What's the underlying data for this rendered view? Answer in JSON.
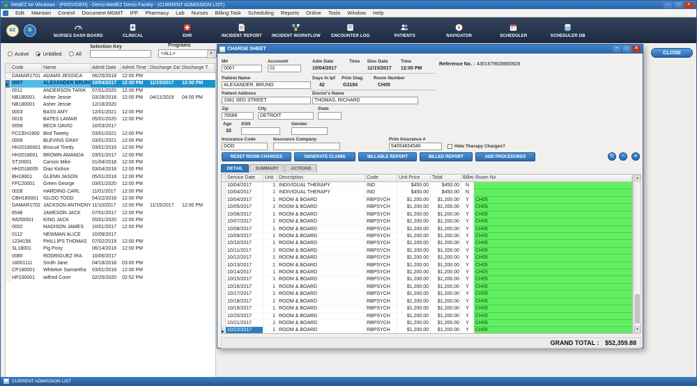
{
  "window": {
    "title": "MedEZ for Windows - [PROVIDER] - Demo-MedEZ Demo Facility - (CURRENT ADMISSION LIST)",
    "controls": {
      "minimize": "–",
      "maximize": "□",
      "close": "×"
    }
  },
  "menu": {
    "items": [
      "Edit",
      "Maintain",
      "Control",
      "Document MGMT",
      "IPF",
      "Pharmacy",
      "Lab",
      "Nurses",
      "Billing Task",
      "Scheduling",
      "Reports",
      "Online",
      "Tools",
      "Window",
      "Help"
    ]
  },
  "toolbar": {
    "badges": [
      {
        "label": "EZ"
      },
      {
        "label": "D"
      }
    ],
    "items": [
      {
        "label": "NURSES DASH BOARD",
        "icon": "dashboard-icon"
      },
      {
        "label": "CLINICAL",
        "icon": "clinical-icon"
      },
      {
        "label": "EHR",
        "icon": "ehr-icon"
      },
      {
        "label": "INCIDENT REPORT",
        "icon": "incident-report-icon"
      },
      {
        "label": "INCIDENT WORKFLOW",
        "icon": "incident-workflow-icon"
      },
      {
        "label": "ENCOUNTER LOG",
        "icon": "encounter-log-icon"
      },
      {
        "label": "PATIENTS",
        "icon": "patients-icon"
      },
      {
        "label": "NAVIGATOR",
        "icon": "navigator-icon"
      },
      {
        "label": "SCHEDULER",
        "icon": "scheduler-icon"
      },
      {
        "label": "SCHEDULER DB",
        "icon": "scheduler-db-icon"
      }
    ]
  },
  "filters": {
    "radios": [
      {
        "label": "Active",
        "checked": false
      },
      {
        "label": "Unbilled",
        "checked": true
      },
      {
        "label": "All",
        "checked": false
      }
    ],
    "selection_key_label": "Selection Key",
    "selection_key_value": "",
    "programs_label": "Programs",
    "programs_value": "<ALL>"
  },
  "close_button_label": "CLOSE",
  "admission_grid": {
    "columns": [
      "Code",
      "Name",
      "Admit Date",
      "Admit Time",
      "Discharge Date",
      "Discharge T"
    ],
    "selected_index": 1,
    "rows": [
      [
        "DAMAR1701",
        "ADAMS JESSICA",
        "06/25/2018",
        "12:00 PM",
        "",
        ""
      ],
      [
        "0067",
        "ALEXANDER BRUNO",
        "10/04/2017",
        "12:00 PM",
        "11/15/2017",
        "12:00 PM"
      ],
      [
        "0011",
        "ANDERSON TARIK",
        "07/01/2020",
        "12:00 PM",
        "",
        ""
      ],
      [
        "NB180001",
        "Asher Jessie",
        "03/28/2018",
        "12:00 PM",
        "04/11/2019",
        "04:00 PM"
      ],
      [
        "NB180001",
        "Asher Jessie",
        "12/18/2020",
        "",
        "",
        ""
      ],
      [
        "0003",
        "BASS AMY",
        "12/01/2021",
        "12:00 PM",
        "",
        ""
      ],
      [
        "0016",
        "BATES LAMAR",
        "05/01/2020",
        "12:00 PM",
        "",
        ""
      ],
      [
        "0058",
        "BECK DAVID",
        "10/03/2017",
        "",
        "",
        ""
      ],
      [
        "FCCEH1900",
        "Bird Tweety",
        "03/01/2021",
        "12:00 PM",
        "",
        ""
      ],
      [
        "0009",
        "BLEVINS GRAY",
        "03/01/2021",
        "12:00 PM",
        "",
        ""
      ],
      [
        "HH20180001",
        "Briscuit Tiredy",
        "03/01/2016",
        "12:00 PM",
        "",
        ""
      ],
      [
        "HH2018001",
        "BROWN AMANDA",
        "03/01/2017",
        "12:00 PM",
        "",
        ""
      ],
      [
        "ST20001",
        "Carson Mike",
        "01/04/2018",
        "12:00 PM",
        "",
        ""
      ],
      [
        "HH2018005",
        "Diaz Kishon",
        "03/04/2018",
        "12:00 PM",
        "",
        ""
      ],
      [
        "BH18001",
        "GLENN JASON",
        "05/01/2018",
        "12:00 PM",
        "",
        ""
      ],
      [
        "FFC20001",
        "Green George",
        "03/01/2020",
        "12:00 PM",
        "",
        ""
      ],
      [
        "0028",
        "HARDING CARL",
        "11/01/2017",
        "12:00 PM",
        "",
        ""
      ],
      [
        "CBH180001",
        "IGLOO TODD",
        "04/22/2018",
        "12:00 PM",
        "",
        ""
      ],
      [
        "DAMAR1702",
        "JACKSON ANTHONY",
        "11/10/2017",
        "12:00 PM",
        "11/15/2017",
        "12:00 PM"
      ],
      [
        "6548",
        "JAMESON JACK",
        "07/01/2017",
        "12:00 PM",
        "",
        ""
      ],
      [
        "IM200001",
        "KING JACK",
        "05/01/2020",
        "12:00 PM",
        "",
        ""
      ],
      [
        "0002",
        "MADISON JAMES",
        "10/01/2017",
        "12:00 PM",
        "",
        ""
      ],
      [
        "0112",
        "NEWMAN ALICE",
        "10/09/2017",
        "",
        "",
        ""
      ],
      [
        "1234156",
        "PHILLIPS THOMAS",
        "07/02/2019",
        "12:00 PM",
        "",
        ""
      ],
      [
        "SL18001",
        "Pig Pony",
        "06/14/2018",
        "12:00 PM",
        "",
        ""
      ],
      [
        "0080",
        "RODRIGUEZ IRA",
        "10/05/2017",
        "",
        "",
        ""
      ],
      [
        "18001111",
        "Smith Jane",
        "04/18/2018",
        "03:00 PM",
        "",
        ""
      ],
      [
        "CP180001",
        "Whiteker Samantha",
        "03/01/2018",
        "12:00 PM",
        "",
        ""
      ],
      [
        "HP230001",
        "wilfred Corer",
        "02/25/2020",
        "02:52 PM",
        "",
        ""
      ]
    ]
  },
  "charge_sheet": {
    "title": "CHARGE SHEET",
    "fields": {
      "mr": {
        "label": "M#",
        "value": "0067"
      },
      "account": {
        "label": "Account#",
        "value": "01"
      },
      "adm_date": {
        "label": "Adm Date",
        "value": "10/04/2017"
      },
      "adm_time": {
        "label": "Time",
        "value": ""
      },
      "disc_date": {
        "label": "Disc Date",
        "value": "11/15/2017"
      },
      "disc_time": {
        "label": "Time",
        "value": "12:00 PM"
      },
      "reference": {
        "label": "Reference No. :",
        "value": "4301679928865928"
      },
      "patient_name": {
        "label": "Patient Name",
        "value": "ALEXANDER, BRUNO"
      },
      "days_in_ipf": {
        "label": "Days In Ipf",
        "value": "42"
      },
      "prim_diag": {
        "label": "Prim Diag",
        "value": "G3184"
      },
      "room_number": {
        "label": "Room Number",
        "value": "CH05"
      },
      "patient_address": {
        "label": "Patient Address",
        "value": "1581 SED STREET"
      },
      "doctor_name": {
        "label": "Doctor's Name",
        "value": "THOMAS, RICHARD"
      },
      "zip": {
        "label": "Zip",
        "value": "76586"
      },
      "city": {
        "label": "City",
        "value": "DETROIT"
      },
      "state": {
        "label": "State",
        "value": ""
      },
      "age": {
        "label": "Age",
        "value": "33"
      },
      "ssn": {
        "label": "SSN",
        "value": ""
      },
      "gender": {
        "label": "Gender",
        "value": ""
      },
      "insurance_code": {
        "label": "Insurance Code",
        "value": "DOD"
      },
      "insurance_company": {
        "label": "Insurance Company",
        "value": ""
      },
      "prim_insurance": {
        "label": "Prim Insurance #",
        "value": "54654654546"
      },
      "hide_therapy": {
        "label": "Hide Therapy Charges?"
      }
    },
    "buttons": [
      "RESET ROOM CHARGES",
      "GENERATE CLAIMS",
      "BILLABLE REPORT",
      "BILLED REPORT",
      "ADD PROCEDURES"
    ],
    "tabs": [
      {
        "label": "DETAIL",
        "active": true
      },
      {
        "label": "SUMMARY",
        "active": false
      },
      {
        "label": "ACTIONS",
        "active": false
      }
    ],
    "grid": {
      "columns": [
        "Service Date",
        "Unit",
        "Description",
        "Code",
        "Unit Price",
        "Total",
        "Billed",
        "Room No"
      ],
      "selected_row": 20,
      "rows": [
        [
          "10/04/2017",
          "1",
          "INDIVIDUAL THERAPY",
          "IND",
          "$450.00",
          "$450.00",
          "N",
          ""
        ],
        [
          "10/04/2017",
          "1",
          "INDIVIDUAL THERAPY",
          "IND",
          "$450.00",
          "$450.00",
          "N",
          ""
        ],
        [
          "10/04/2017",
          "1",
          "ROOM & BOARD",
          "RBPSYCH",
          "$1,200.00",
          "$1,200.00",
          "Y",
          "CH05"
        ],
        [
          "10/05/2017",
          "1",
          "ROOM & BOARD",
          "RBPSYCH",
          "$1,200.00",
          "$1,200.00",
          "Y",
          "CH05"
        ],
        [
          "10/06/2017",
          "1",
          "ROOM & BOARD",
          "RBPSYCH",
          "$1,200.00",
          "$1,200.00",
          "Y",
          "CH05"
        ],
        [
          "10/07/2017",
          "1",
          "ROOM & BOARD",
          "RBPSYCH",
          "$1,200.00",
          "$1,200.00",
          "Y",
          "CH05"
        ],
        [
          "10/08/2017",
          "1",
          "ROOM & BOARD",
          "RBPSYCH",
          "$1,200.00",
          "$1,200.00",
          "Y",
          "CH05"
        ],
        [
          "10/09/2017",
          "1",
          "ROOM & BOARD",
          "RBPSYCH",
          "$1,200.00",
          "$1,200.00",
          "Y",
          "CH05"
        ],
        [
          "10/10/2017",
          "1",
          "ROOM & BOARD",
          "RBPSYCH",
          "$1,200.00",
          "$1,200.00",
          "Y",
          "CH05"
        ],
        [
          "10/11/2017",
          "1",
          "ROOM & BOARD",
          "RBPSYCH",
          "$1,200.00",
          "$1,200.00",
          "Y",
          "CH05"
        ],
        [
          "10/12/2017",
          "1",
          "ROOM & BOARD",
          "RBPSYCH",
          "$1,200.00",
          "$1,200.00",
          "Y",
          "CH05"
        ],
        [
          "10/13/2017",
          "1",
          "ROOM & BOARD",
          "RBPSYCH",
          "$1,200.00",
          "$1,200.00",
          "Y",
          "CH05"
        ],
        [
          "10/14/2017",
          "1",
          "ROOM & BOARD",
          "RBPSYCH",
          "$1,200.00",
          "$1,200.00",
          "Y",
          "CH05"
        ],
        [
          "10/15/2017",
          "1",
          "ROOM & BOARD",
          "RBPSYCH",
          "$1,200.00",
          "$1,200.00",
          "Y",
          "CH05"
        ],
        [
          "10/16/2017",
          "1",
          "ROOM & BOARD",
          "RBPSYCH",
          "$1,200.00",
          "$1,200.00",
          "Y",
          "CH05"
        ],
        [
          "10/17/2017",
          "1",
          "ROOM & BOARD",
          "RBPSYCH",
          "$1,200.00",
          "$1,200.00",
          "Y",
          "CH05"
        ],
        [
          "10/18/2017",
          "1",
          "ROOM & BOARD",
          "RBPSYCH",
          "$1,200.00",
          "$1,200.00",
          "Y",
          "CH05"
        ],
        [
          "10/19/2017",
          "1",
          "ROOM & BOARD",
          "RBPSYCH",
          "$1,200.00",
          "$1,200.00",
          "Y",
          "CH05"
        ],
        [
          "10/20/2017",
          "1",
          "ROOM & BOARD",
          "RBPSYCH",
          "$1,200.00",
          "$1,200.00",
          "Y",
          "CH05"
        ],
        [
          "10/21/2017",
          "1",
          "ROOM & BOARD",
          "RBPSYCH",
          "$1,200.00",
          "$1,200.00",
          "Y",
          "CH05"
        ],
        [
          "10/22/2017",
          "1",
          "ROOM & BOARD",
          "RBPSYCH",
          "$1,200.00",
          "$1,200.00",
          "Y",
          "CH05"
        ]
      ]
    },
    "grand_total_label": "GRAND TOTAL :",
    "grand_total_value": "$52,359.88"
  },
  "statusbar": {
    "text": "CURRENT ADMISSION LIST"
  }
}
